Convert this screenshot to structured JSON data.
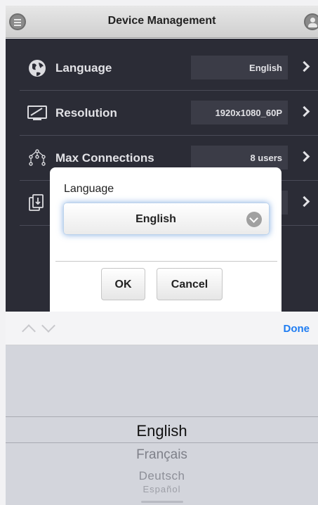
{
  "header": {
    "title": "Device Management",
    "menu_icon": "menu-icon",
    "user_icon": "user-icon"
  },
  "settings": [
    {
      "icon": "globe-icon",
      "label": "Language",
      "value": "English"
    },
    {
      "icon": "monitor-icon",
      "label": "Resolution",
      "value": "1920x1080_60P"
    },
    {
      "icon": "network-icon",
      "label": "Max Connections",
      "value": "8 users"
    },
    {
      "icon": "import-icon",
      "label": "",
      "value": ""
    }
  ],
  "dialog": {
    "label": "Language",
    "selected": "English",
    "ok_label": "OK",
    "cancel_label": "Cancel"
  },
  "accessory": {
    "done_label": "Done"
  },
  "picker": {
    "options": [
      "English",
      "Français",
      "Deutsch",
      "Español"
    ],
    "selected_index": 0
  },
  "colors": {
    "list_bg": "#2b2c36",
    "accent": "#1e7cf2",
    "focus_glow": "#6296da"
  }
}
